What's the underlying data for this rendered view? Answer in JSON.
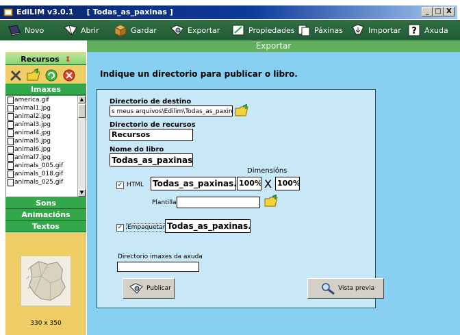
{
  "window": {
    "title": "EdiLIM v3.0.1     [ Todas_as_paxinas ]",
    "controls": [
      "_",
      "□",
      "X"
    ]
  },
  "toolbar": {
    "items": [
      {
        "label": "Novo",
        "icon": "book-icon"
      },
      {
        "label": "Abrir",
        "icon": "open-folder-icon"
      },
      {
        "label": "Gardar",
        "icon": "box-icon"
      },
      {
        "label": "Exportar",
        "icon": "export-icon"
      },
      {
        "label": "Propiedades",
        "icon": "properties-icon"
      },
      {
        "label": "Páxinas",
        "icon": "pages-icon"
      },
      {
        "label": "Importar",
        "icon": "import-icon"
      },
      {
        "label": "Axuda",
        "icon": "help-icon"
      }
    ]
  },
  "section": {
    "title": "Exportar"
  },
  "sidebar": {
    "recursos_label": "Recursos",
    "imaxes_label": "Imaxes",
    "files": [
      "america.gif",
      "animal1.jpg",
      "animal2.jpg",
      "animal3.jpg",
      "animal4.jpg",
      "animal5.jpg",
      "animal6.jpg",
      "animal7.jpg",
      "animals_005.gif",
      "animals_018.gif",
      "animals_025.gif"
    ],
    "sons_label": "Sons",
    "animacions_label": "Animacións",
    "textos_label": "Textos",
    "map_caption": "330 x 350"
  },
  "main": {
    "heading": "Indique un directorio para publicar o libro.",
    "dest_label": "Directorio de destino",
    "dest_value": "s meus arquivos\\Edilim\\Todas_as_paxinas\\",
    "resources_label": "Directorio de recursos",
    "resources_value": "Recursos",
    "book_name_label": "Nome do libro",
    "book_name_value": "Todas_as_paxinas.li",
    "dimensions_label": "Dimensións",
    "html_checked": true,
    "html_label": "HTML",
    "html_value": "Todas_as_paxinas.h",
    "width_value": "100%",
    "height_value": "100%",
    "times_sign": "X",
    "template_label": "Plantilla",
    "template_value": "",
    "package_checked": true,
    "package_label": "Empaquetar",
    "package_value": "Todas_as_paxinas.z",
    "help_images_label": "Directorio imaxes da axuda",
    "help_images_value": "",
    "publish_label": "Publicar",
    "preview_label": "Vista previa"
  }
}
